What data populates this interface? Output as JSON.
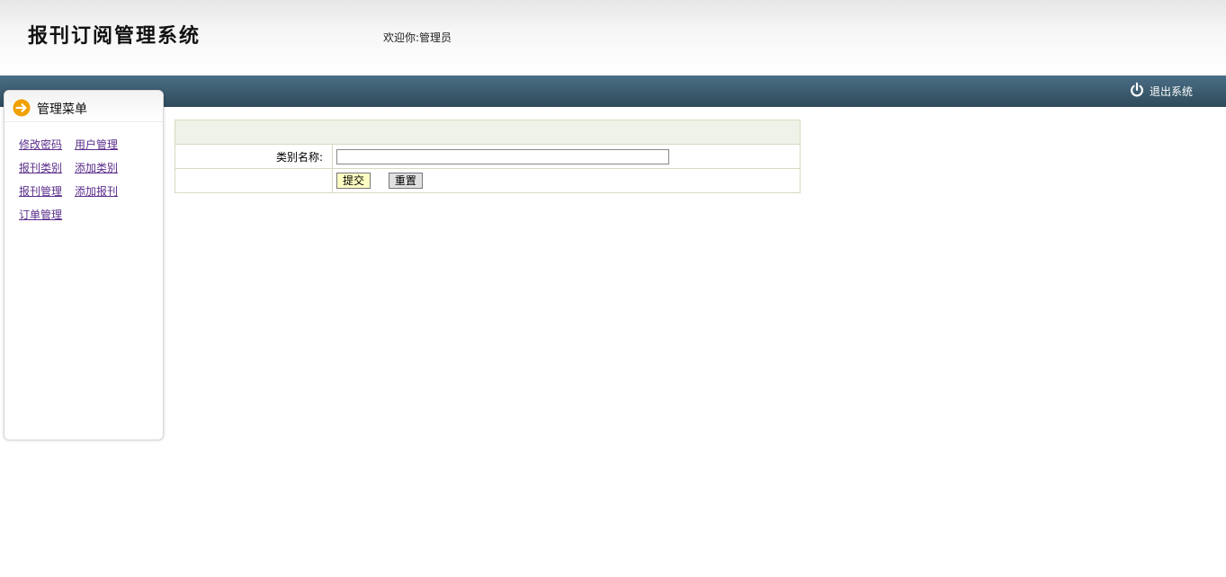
{
  "header": {
    "logo": "报刊订阅管理系统",
    "welcome": "欢迎你:管理员"
  },
  "topbar": {
    "logout_label": "退出系统",
    "logout_icon": "power-icon"
  },
  "sidebar": {
    "title": "管理菜单",
    "title_icon": "arrow-right-icon",
    "items": [
      {
        "label": "修改密码"
      },
      {
        "label": "用户管理"
      },
      {
        "label": "报刊类别"
      },
      {
        "label": "添加类别"
      },
      {
        "label": "报刊管理"
      },
      {
        "label": "添加报刊"
      },
      {
        "label": "订单管理"
      }
    ]
  },
  "form": {
    "name_label": "类别名称:",
    "name_value": "",
    "submit_label": "提交",
    "reset_label": "重置"
  },
  "colors": {
    "topbar": "#3c5c70",
    "link": "#5a2d8a",
    "accent_icon": "#f0a000",
    "form_border": "#d4dcc0",
    "form_header": "#eef2e8",
    "submit_bg": "#ffffc4"
  }
}
